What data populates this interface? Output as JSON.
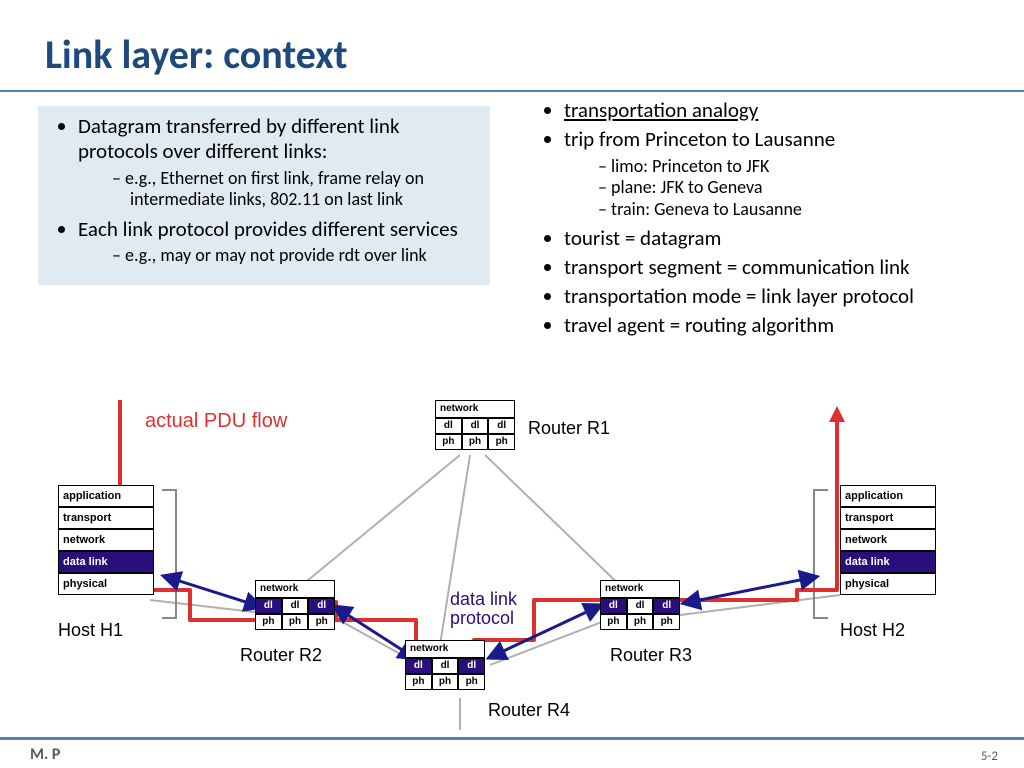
{
  "title": "Link layer: context",
  "left": {
    "b1": "Datagram transferred by different link protocols over different links:",
    "b1a": "e.g., Ethernet on first link, frame relay on intermediate links, 802.11 on last link",
    "b2": "Each  link protocol provides different services",
    "b2a": "e.g., may or may not provide rdt over link"
  },
  "right": {
    "r1": "transportation analogy",
    "r2": "trip from Princeton to Lausanne",
    "r2a": "limo: Princeton to JFK",
    "r2b": "plane: JFK to Geneva",
    "r2c": "train: Geneva to Lausanne",
    "r3": "tourist = datagram",
    "r4": "transport segment = communication link",
    "r5": "transportation mode = link layer protocol",
    "r6": "travel agent = routing algorithm"
  },
  "diagram": {
    "pdu": "actual PDU flow",
    "dlp1": "data link",
    "dlp2": "protocol",
    "host_layers": {
      "app": "application",
      "tra": "transport",
      "net": "network",
      "dl": "data link",
      "phy": "physical"
    },
    "r_net": "network",
    "r_dl": "dl",
    "r_ph": "ph",
    "h1": "Host H1",
    "h2": "Host H2",
    "rr1": "Router R1",
    "rr2": "Router R2",
    "rr3": "Router R3",
    "rr4": "Router R4"
  },
  "footer": {
    "left": "M. P",
    "right": "5-2"
  }
}
